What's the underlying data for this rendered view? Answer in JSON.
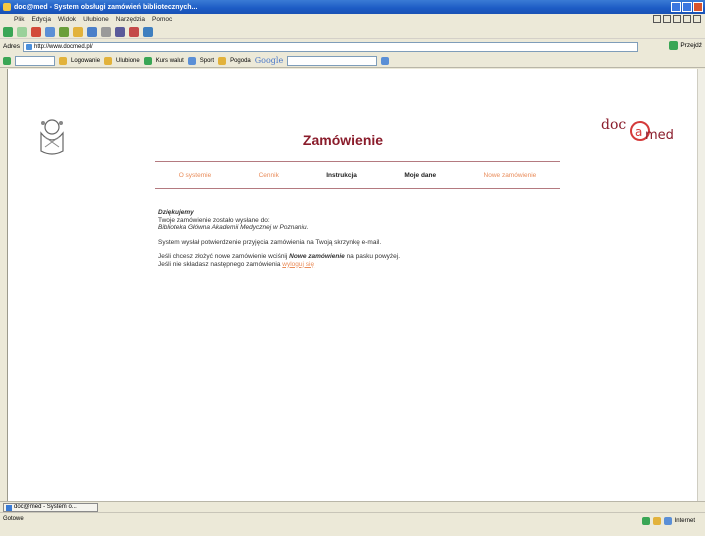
{
  "window": {
    "title": "doc@med - System obsługi zamówień bibliotecznych..."
  },
  "menu": [
    "Plik",
    "Edycja",
    "Widok",
    "Ulubione",
    "Narzędzia",
    "Pomoc"
  ],
  "address": {
    "label": "Adres",
    "url": "http://www.docmed.pl/",
    "go_label": "Przejdź"
  },
  "links_bar": {
    "items": [
      "Logowanie",
      "Ulubione",
      "Kurs walut",
      "Sport",
      "Pogoda"
    ],
    "google_label": "Google"
  },
  "page": {
    "title": "Zamówienie",
    "logo_right_text": "doc@med",
    "nav": [
      {
        "label": "O systemie",
        "active": false
      },
      {
        "label": "Cennik",
        "active": false
      },
      {
        "label": "Instrukcja",
        "active": true
      },
      {
        "label": "Moje dane",
        "active": false
      },
      {
        "label": "Nowe zamówienie",
        "active": false
      }
    ],
    "content": {
      "greeting": "Dziękujemy",
      "line1": "Twoje zamówienie zostało wysłane do:",
      "line2": "Biblioteka Główna Akademii Medycznej w Poznaniu.",
      "confirmation": "System wysłał potwierdzenie przyjęcia zamówienia na Twoją skrzynkę e-mail.",
      "new_order_pre": "Jeśli chcesz złożyć nowe zamówienie wciśnij ",
      "new_order_bold": "Nowe zamówienie",
      "new_order_post": " na pasku powyżej.",
      "logout_pre": "Jeśli nie składasz następnego zamówienia ",
      "logout_link": "wyloguj się"
    }
  },
  "taskbar": {
    "task_label": "doc@med - System o..."
  },
  "statusbar": {
    "status": "Gotowe",
    "zone": "Internet"
  },
  "colors": {
    "title": "#8a1c2b",
    "nav_inactive": "#e98c5a",
    "nav_border": "#b47a80",
    "link": "#e98c5a"
  }
}
